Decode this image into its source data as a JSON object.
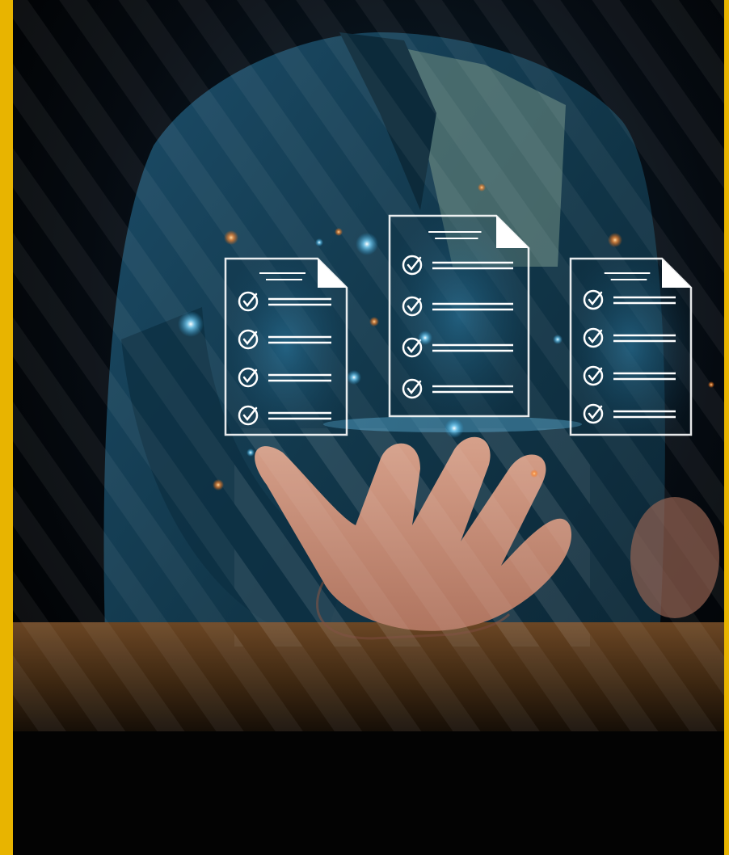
{
  "image": {
    "description_icons": [
      "checklist-document-icon",
      "checkmark-icon"
    ],
    "colors": {
      "gold_frame": "#e8b400",
      "background": "#040608",
      "shirt": "#123a52",
      "glow": "#6fd2ff",
      "doc_line": "#ffffff",
      "sparkle_warm": "#ff9a3c",
      "table": "#5a3a1c"
    },
    "documents": [
      {
        "name": "left",
        "checklist_items": 4
      },
      {
        "name": "center",
        "checklist_items": 4
      },
      {
        "name": "right",
        "checklist_items": 4
      }
    ]
  }
}
